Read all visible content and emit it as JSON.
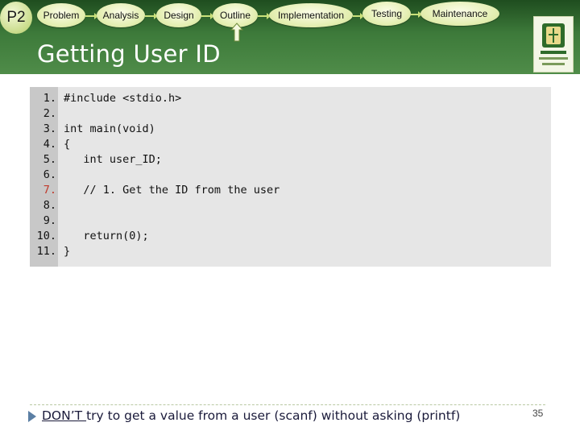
{
  "header": {
    "section_badge": "P2",
    "steps": [
      "Problem",
      "Analysis",
      "Design",
      "Outline",
      "Implementation",
      "Testing",
      "Maintenance"
    ],
    "current_step": "Outline",
    "title": "Getting User ID"
  },
  "colors": {
    "header_green": "#3d7a3a",
    "step_pill": "#e3eeb0",
    "code_bg": "#e6e6e6",
    "highlight_line": "#c0392b"
  },
  "code": {
    "line_numbers": [
      "1.",
      "2.",
      "3.",
      "4.",
      "5.",
      "6.",
      "7.",
      "8.",
      "9.",
      "10.",
      "11."
    ],
    "highlighted_line": "7.",
    "lines": [
      "#include <stdio.h>",
      "",
      "int main(void)",
      "{",
      "   int user_ID;",
      "",
      "   // 1. Get the ID from the user",
      "",
      "",
      "   return(0);",
      "}"
    ]
  },
  "footer": {
    "note_emphasis": "DON’T ",
    "note_rest": " try to get a value from a user (scanf) without asking (printf)",
    "page_number": "35"
  }
}
